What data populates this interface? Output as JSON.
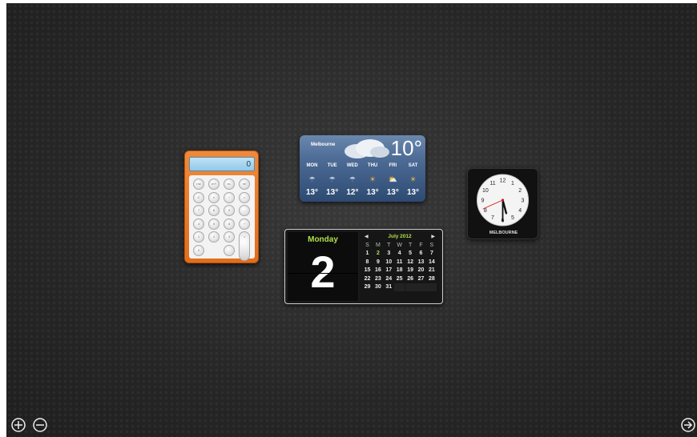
{
  "calculator": {
    "display": "0",
    "keys": [
      "mc",
      "m+",
      "m-",
      "m/",
      "C",
      "±",
      "÷",
      "×",
      "7",
      "8",
      "9",
      "-",
      "4",
      "5",
      "6",
      "+",
      "1",
      "2",
      "3",
      "=",
      "0",
      "."
    ]
  },
  "weather": {
    "city": "Melbourne",
    "temperature": "10°",
    "days": [
      "MON",
      "TUE",
      "WED",
      "THU",
      "FRI",
      "SAT"
    ],
    "temps": [
      "13°",
      "13°",
      "12°",
      "13°",
      "13°",
      "13°"
    ],
    "icons": [
      "rain-icon",
      "rain-icon",
      "rain-icon",
      "sun-icon",
      "partly-sunny-icon",
      "sun-icon"
    ]
  },
  "calendar": {
    "weekday": "Monday",
    "day": "2",
    "month_label": "July 2012",
    "weekday_headers": [
      "S",
      "M",
      "T",
      "W",
      "T",
      "F",
      "S"
    ],
    "weeks": [
      [
        "1",
        "2",
        "3",
        "4",
        "5",
        "6",
        "7"
      ],
      [
        "8",
        "9",
        "10",
        "11",
        "12",
        "13",
        "14"
      ],
      [
        "15",
        "16",
        "17",
        "18",
        "19",
        "20",
        "21"
      ],
      [
        "22",
        "23",
        "24",
        "25",
        "26",
        "27",
        "28"
      ],
      [
        "29",
        "30",
        "31",
        "",
        "",
        "",
        ""
      ]
    ],
    "today": "2"
  },
  "clock": {
    "city": "MELBOURNE",
    "hour": 5,
    "minute": 30,
    "second": 41
  },
  "controls": {
    "add": "add-widget-icon",
    "remove": "remove-widget-icon",
    "next": "next-arrow-icon"
  }
}
